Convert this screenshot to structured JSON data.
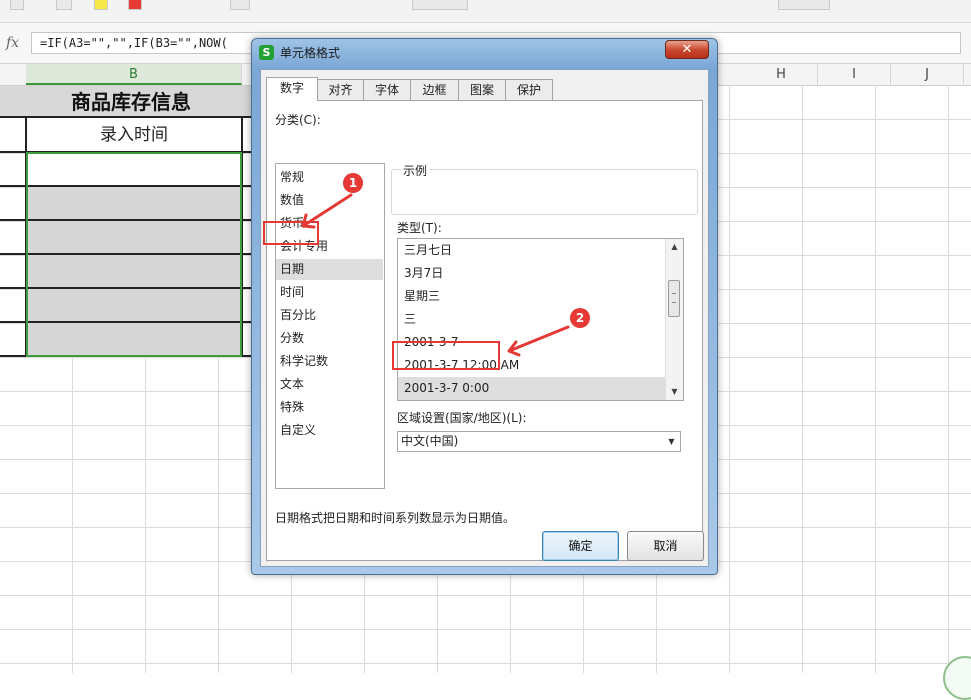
{
  "spreadsheet": {
    "formula": "=IF(A3=\"\",\"\",IF(B3=\"\",NOW(",
    "columns": [
      "B",
      "H",
      "I",
      "J"
    ],
    "title": "商品库存信息",
    "header_cell": "录入时间"
  },
  "dialog": {
    "logo_letter": "S",
    "title": "单元格格式",
    "close_symbol": "✕",
    "tabs": [
      "数字",
      "对齐",
      "字体",
      "边框",
      "图案",
      "保护"
    ],
    "active_tab": "数字",
    "category_label": "分类(C):",
    "categories": [
      "常规",
      "数值",
      "货币",
      "会计专用",
      "日期",
      "时间",
      "百分比",
      "分数",
      "科学记数",
      "文本",
      "特殊",
      "自定义"
    ],
    "selected_category": "日期",
    "sample_label": "示例",
    "type_label": "类型(T):",
    "types": [
      "三月七日",
      "3月7日",
      "星期三",
      "三",
      "2001-3-7",
      "2001-3-7 12:00 AM",
      "2001-3-7 0:00"
    ],
    "selected_type": "2001-3-7 0:00",
    "locale_label": "区域设置(国家/地区)(L):",
    "locale_value": "中文(中国)",
    "description": "日期格式把日期和时间系列数显示为日期值。",
    "ok_label": "确定",
    "cancel_label": "取消"
  },
  "annotations": {
    "badge1": "1",
    "badge2": "2",
    "color": "#e53935"
  }
}
